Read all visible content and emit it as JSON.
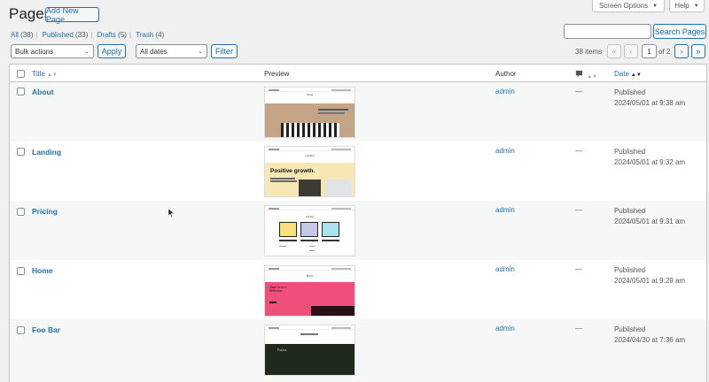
{
  "header": {
    "title": "Pages",
    "add_new_label": "Add New Page",
    "screen_options_label": "Screen Options",
    "help_label": "Help"
  },
  "views": {
    "all_label": "All",
    "all_count": "(38)",
    "published_label": "Published",
    "published_count": "(33)",
    "drafts_label": "Drafts",
    "drafts_count": "(5)",
    "trash_label": "Trash",
    "trash_count": "(4)"
  },
  "search": {
    "button_label": "Search Pages",
    "value": ""
  },
  "filters": {
    "bulk_actions_label": "Bulk actions",
    "apply_label": "Apply",
    "dates_label": "All dates",
    "filter_label": "Filter"
  },
  "pagination": {
    "items_text": "38 items",
    "first": "«",
    "prev": "‹",
    "next": "›",
    "last": "»",
    "current_page": "1",
    "of_text": "of 2"
  },
  "table": {
    "columns": {
      "title": "Title",
      "preview": "Preview",
      "author": "Author",
      "date": "Date"
    },
    "rows": [
      {
        "title": "About",
        "author": "admin",
        "comments": "—",
        "status": "Published",
        "date": "2024/05/01 at 9:38 am"
      },
      {
        "title": "Landing",
        "author": "admin",
        "comments": "—",
        "status": "Published",
        "date": "2024/05/01 at 9:32 am"
      },
      {
        "title": "Pricing",
        "author": "admin",
        "comments": "—",
        "status": "Published",
        "date": "2024/05/01 at 9:31 am"
      },
      {
        "title": "Home",
        "author": "admin",
        "comments": "—",
        "status": "Published",
        "date": "2024/05/01 at 9:29 am"
      },
      {
        "title": "Foo Bar",
        "author": "admin",
        "comments": "—",
        "status": "Published",
        "date": "2024/04/30 at 7:36 am"
      }
    ]
  },
  "previews": {
    "about": {
      "heading": "About",
      "color": "#c4a484"
    },
    "landing": {
      "heading": "Landing",
      "headline": "Positive growth.",
      "color": "#f7e7b4"
    },
    "pricing": {
      "heading": "Pricing",
      "card_colors": [
        "#f9e27d",
        "#c7c7e6",
        "#a8e3ef"
      ]
    },
    "home": {
      "heading": "Home",
      "headline": "Tune in to a delicious",
      "color": "#ee4f7b"
    },
    "foobar": {
      "heading": "Forest.",
      "color": "#1f2a1c"
    }
  },
  "colors": {
    "accent": "#2271b1",
    "background": "#f0f0f1"
  }
}
